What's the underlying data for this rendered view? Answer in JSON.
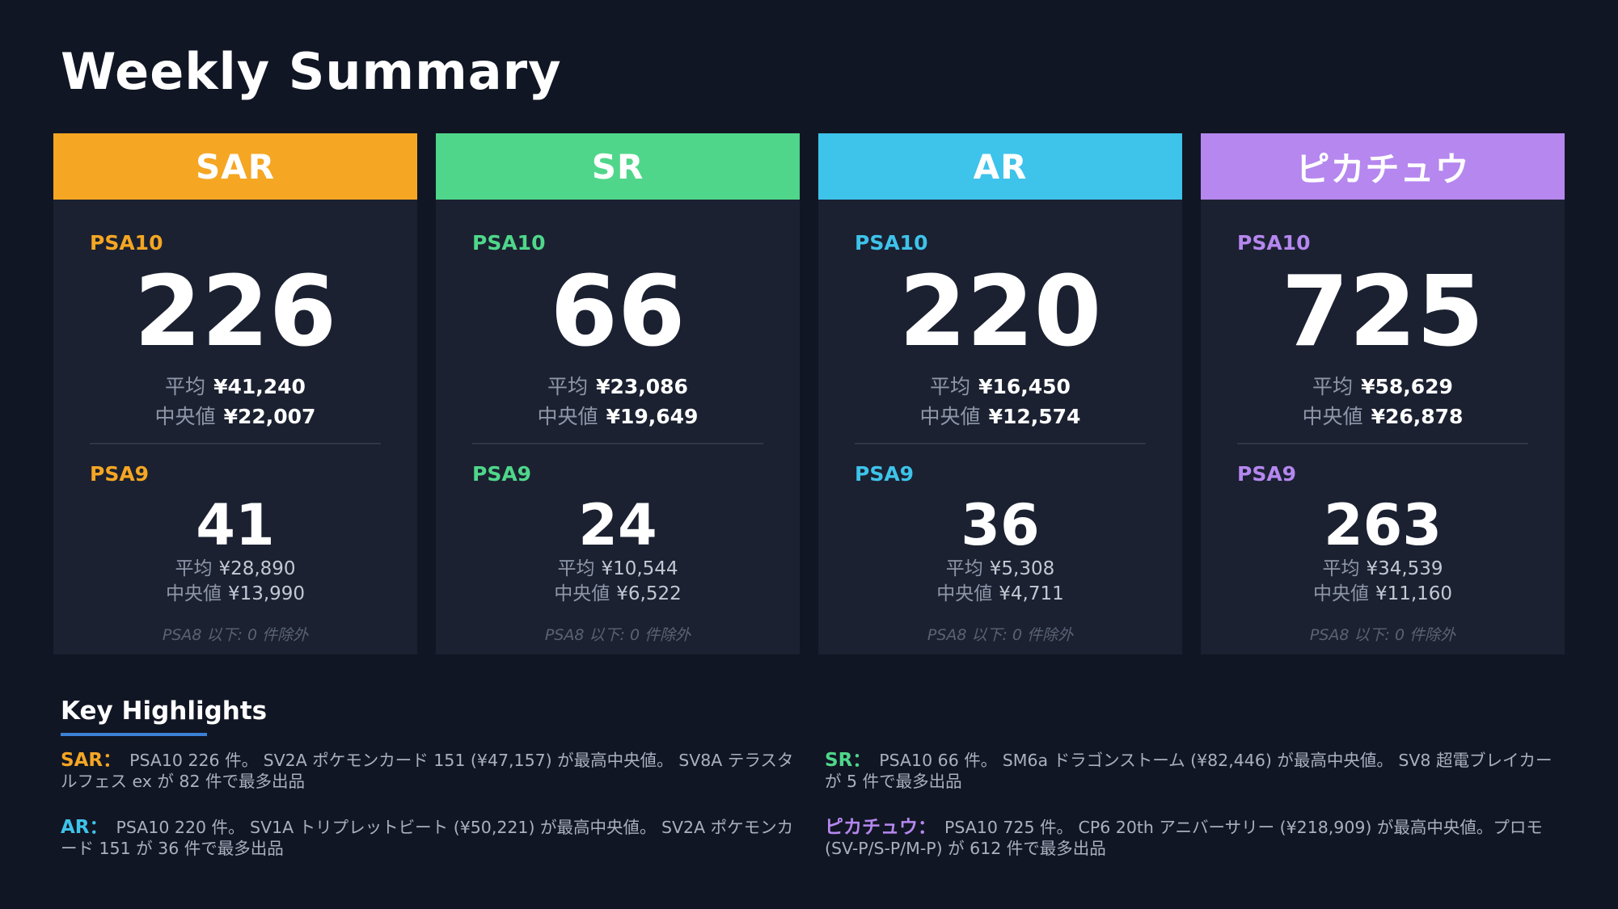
{
  "page": {
    "title": "Weekly Summary"
  },
  "colors": {
    "background": "#111624",
    "card": "#1b2131",
    "SAR": "#f5a623",
    "SR": "#4fd68a",
    "AR": "#3ec3ea",
    "pikachu": "#b587ef",
    "underline": "#3b82d6"
  },
  "cards": [
    {
      "name": "SAR",
      "psa10": {
        "label": "PSA10",
        "count": "226",
        "avg_label": "平均",
        "avg": "¥41,240",
        "median_label": "中央値",
        "median": "¥22,007"
      },
      "psa9": {
        "label": "PSA9",
        "count": "41",
        "avg_label": "平均",
        "avg": "¥28,890",
        "median_label": "中央値",
        "median": "¥13,990"
      },
      "note": "PSA8 以下: 0 件除外"
    },
    {
      "name": "SR",
      "psa10": {
        "label": "PSA10",
        "count": "66",
        "avg_label": "平均",
        "avg": "¥23,086",
        "median_label": "中央値",
        "median": "¥19,649"
      },
      "psa9": {
        "label": "PSA9",
        "count": "24",
        "avg_label": "平均",
        "avg": "¥10,544",
        "median_label": "中央値",
        "median": "¥6,522"
      },
      "note": "PSA8 以下: 0 件除外"
    },
    {
      "name": "AR",
      "psa10": {
        "label": "PSA10",
        "count": "220",
        "avg_label": "平均",
        "avg": "¥16,450",
        "median_label": "中央値",
        "median": "¥12,574"
      },
      "psa9": {
        "label": "PSA9",
        "count": "36",
        "avg_label": "平均",
        "avg": "¥5,308",
        "median_label": "中央値",
        "median": "¥4,711"
      },
      "note": "PSA8 以下: 0 件除外"
    },
    {
      "name": "ピカチュウ",
      "psa10": {
        "label": "PSA10",
        "count": "725",
        "avg_label": "平均",
        "avg": "¥58,629",
        "median_label": "中央値",
        "median": "¥26,878"
      },
      "psa9": {
        "label": "PSA9",
        "count": "263",
        "avg_label": "平均",
        "avg": "¥34,539",
        "median_label": "中央値",
        "median": "¥11,160"
      },
      "note": "PSA8 以下: 0 件除外"
    }
  ],
  "highlights": {
    "title": "Key Highlights",
    "items": [
      {
        "tag": "SAR：",
        "text": "PSA10 226 件。 SV2A ポケモンカード 151 (¥47,157) が最高中央値。 SV8A テラスタルフェス ex が 82 件で最多出品"
      },
      {
        "tag": "SR：",
        "text": "PSA10 66 件。 SM6a ドラゴンストーム (¥82,446) が最高中央値。 SV8 超電ブレイカー が 5 件で最多出品"
      },
      {
        "tag": "AR：",
        "text": "PSA10 220 件。 SV1A トリプレットビート (¥50,221) が最高中央値。 SV2A ポケモンカード 151 が 36 件で最多出品"
      },
      {
        "tag": "ピカチュウ：",
        "text": "PSA10 725 件。 CP6 20th アニバーサリー (¥218,909) が最高中央値。プロモ (SV-P/S-P/M-P) が 612 件で最多出品"
      }
    ]
  }
}
